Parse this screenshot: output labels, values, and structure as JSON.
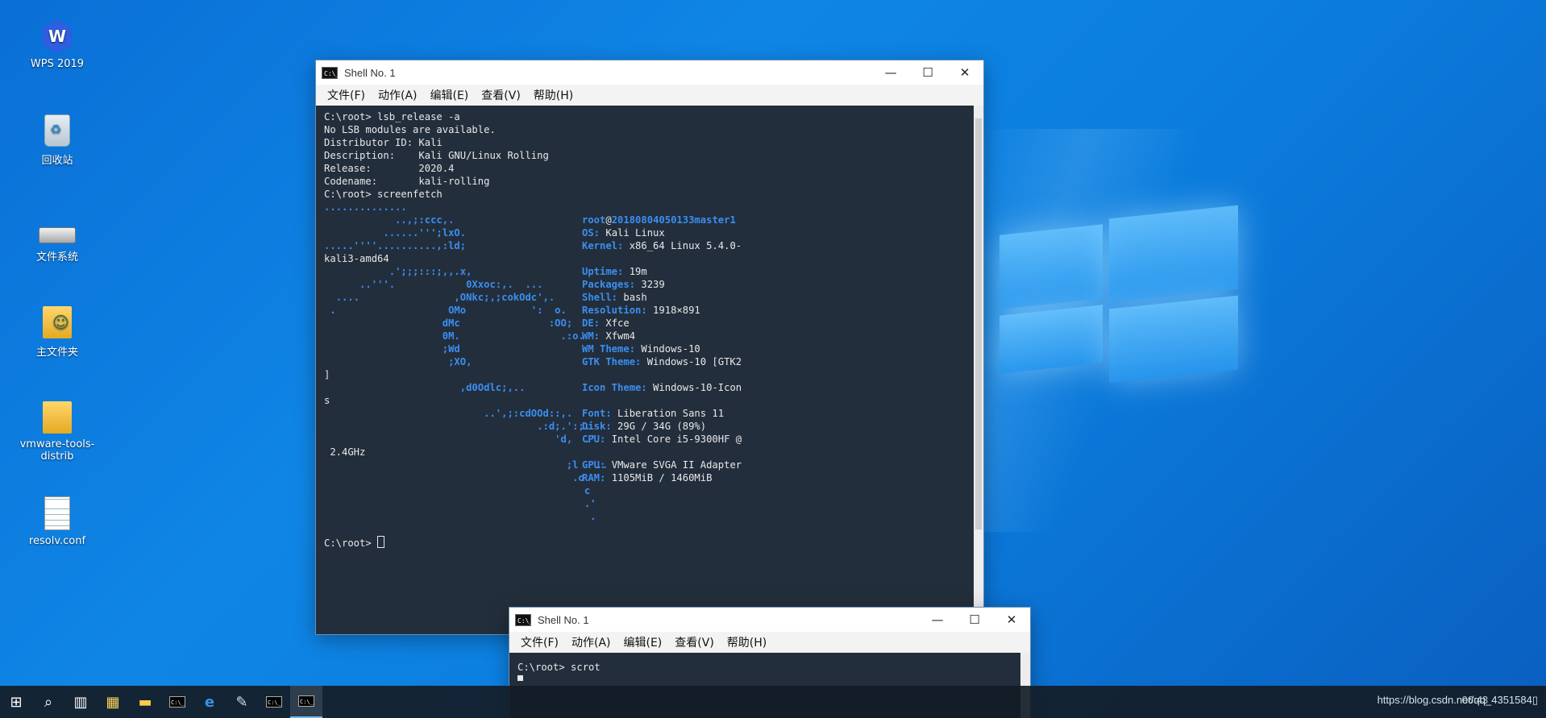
{
  "desktop": {
    "icons": [
      {
        "label": "WPS 2019",
        "icon": "wps-icon"
      },
      {
        "label": "回收站",
        "icon": "recycle-bin-icon"
      },
      {
        "label": "文件系统",
        "icon": "drive-icon"
      },
      {
        "label": "主文件夹",
        "icon": "home-folder-icon"
      },
      {
        "label": "vmware-tools-distrib",
        "icon": "folder-icon"
      },
      {
        "label": "resolv.conf",
        "icon": "file-icon"
      }
    ]
  },
  "window_main": {
    "title": "Shell No. 1",
    "menu": [
      "文件(F)",
      "动作(A)",
      "编辑(E)",
      "查看(V)",
      "帮助(H)"
    ],
    "controls": {
      "minimize": "—",
      "maximize": "☐",
      "close": "✕"
    },
    "terminal": {
      "output": [
        "C:\\root> lsb_release -a",
        "No LSB modules are available.",
        "Distributor ID: Kali",
        "Description:    Kali GNU/Linux Rolling",
        "Release:        2020.4",
        "Codename:       kali-rolling",
        "C:\\root> screenfetch"
      ],
      "art": [
        "..............",
        "            ..,;:ccc,.",
        "          ......''';lxO.",
        ".....''''..........,:ld;",
        "",
        "           .';;;:::;,,.x,",
        "      ..'''.            0Xxoc:,.  ...",
        "  ....                ,ONkc;,;cokOdc',.",
        " .                   OMo           ':  o.",
        "                    dMc               :OO;",
        "                    0M.                 .:o.",
        "                    ;Wd",
        "                     ;XO,",
        "",
        "                       ,d0Odlc;,..",
        "",
        "                           ..',;:cdOOd::,.",
        "                                    .:d;.':;.",
        "                                       'd,  .'",
        "",
        "                                         ;l   ..",
        "                                          .o",
        "                                            c",
        "                                            .'",
        "                                             ."
      ],
      "wraps": [
        {
          "row": 4,
          "text": "kali3-amd64"
        },
        {
          "row": 13,
          "text": "]"
        },
        {
          "row": 15,
          "text": "s"
        },
        {
          "row": 19,
          "text": " 2.4GHz"
        }
      ],
      "info": [
        {
          "key": "root",
          "sep": "@",
          "host": "20180804050133master1"
        },
        {
          "key": "OS:",
          "value": " Kali Linux"
        },
        {
          "key": "Kernel:",
          "value": " x86_64 Linux 5.4.0-"
        },
        {
          "key": "",
          "value": ""
        },
        {
          "key": "Uptime:",
          "value": " 19m"
        },
        {
          "key": "Packages:",
          "value": " 3239"
        },
        {
          "key": "Shell:",
          "value": " bash"
        },
        {
          "key": "Resolution:",
          "value": " 1918×891"
        },
        {
          "key": "DE:",
          "value": " Xfce"
        },
        {
          "key": "WM:",
          "value": " Xfwm4"
        },
        {
          "key": "WM Theme:",
          "value": " Windows-10"
        },
        {
          "key": "GTK Theme:",
          "value": " Windows-10 [GTK2"
        },
        {
          "key": "",
          "value": ""
        },
        {
          "key": "Icon Theme:",
          "value": " Windows-10-Icon"
        },
        {
          "key": "",
          "value": ""
        },
        {
          "key": "Font:",
          "value": " Liberation Sans 11"
        },
        {
          "key": "Disk:",
          "value": " 29G / 34G (89%)"
        },
        {
          "key": "CPU:",
          "value": " Intel Core i5-9300HF @"
        },
        {
          "key": "",
          "value": ""
        },
        {
          "key": "GPU:",
          "value": " VMware SVGA II Adapter"
        },
        {
          "key": "RAM:",
          "value": " 1105MiB / 1460MiB"
        }
      ],
      "prompt": "C:\\root> "
    }
  },
  "window_second": {
    "title": "Shell No. 1",
    "menu": [
      "文件(F)",
      "动作(A)",
      "编辑(E)",
      "查看(V)",
      "帮助(H)"
    ],
    "controls": {
      "minimize": "—",
      "maximize": "☐",
      "close": "✕"
    },
    "terminal": {
      "line": "C:\\root> scrot"
    }
  },
  "taskbar": {
    "tray_text": "https://blog.csdn.net/qq_4351584▯",
    "clock": "06:43"
  }
}
